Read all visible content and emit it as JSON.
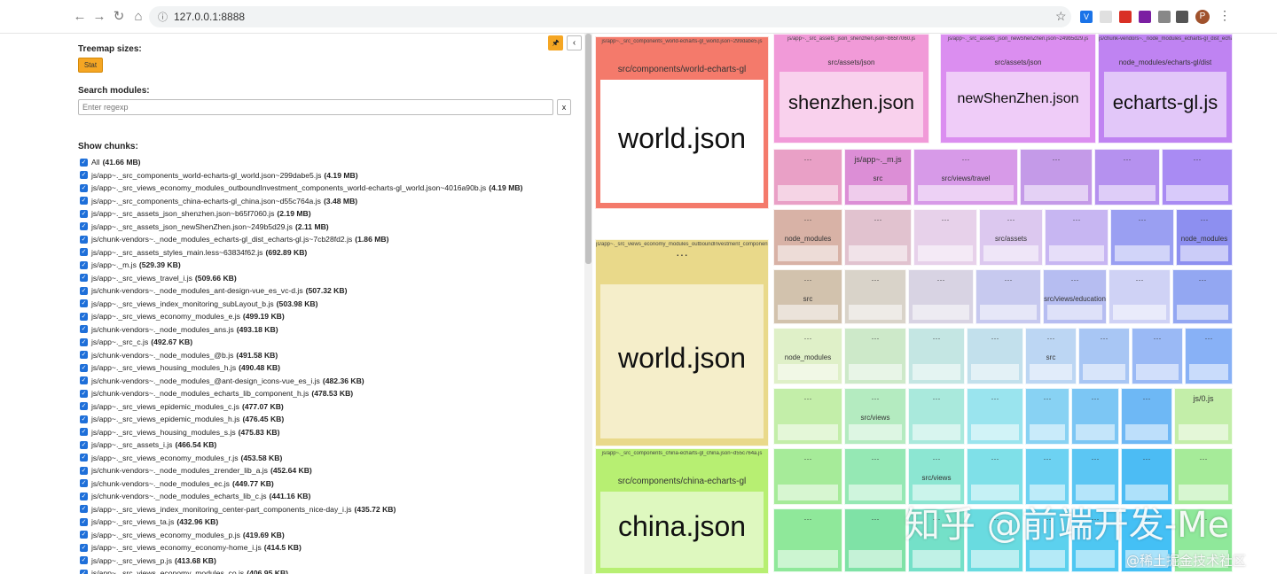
{
  "browser": {
    "url": "127.0.0.1:8888",
    "avatar_letter": "P",
    "menu_glyph": "⋮"
  },
  "sidebar": {
    "treemap_label": "Treemap sizes:",
    "stat_label": "Stat",
    "search_label": "Search modules:",
    "search_placeholder": "Enter regexp",
    "clear_label": "x",
    "pin_label": "🖈",
    "collapse_label": "‹",
    "chunks_label": "Show chunks:",
    "chunks": [
      {
        "name": "All",
        "size": "41.66 MB"
      },
      {
        "name": "js/app~._src_components_world-echarts-gl_world.json~299dabe5.js",
        "size": "4.19 MB"
      },
      {
        "name": "js/app~._src_views_economy_modules_outboundInvestment_components_world-echarts-gl_world.json~4016a90b.js",
        "size": "4.19 MB"
      },
      {
        "name": "js/app~._src_components_china-echarts-gl_china.json~d55c764a.js",
        "size": "3.48 MB"
      },
      {
        "name": "js/app~._src_assets_json_shenzhen.json~b65f7060.js",
        "size": "2.19 MB"
      },
      {
        "name": "js/app~._src_assets_json_newShenZhen.json~249b5d29.js",
        "size": "2.11 MB"
      },
      {
        "name": "js/chunk-vendors~._node_modules_echarts-gl_dist_echarts-gl.js~7cb28fd2.js",
        "size": "1.86 MB"
      },
      {
        "name": "js/app~._src_assets_styles_main.less~63834f62.js",
        "size": "692.89 KB"
      },
      {
        "name": "js/app~._m.js",
        "size": "529.39 KB"
      },
      {
        "name": "js/app~._src_views_travel_i.js",
        "size": "509.66 KB"
      },
      {
        "name": "js/chunk-vendors~._node_modules_ant-design-vue_es_vc-d.js",
        "size": "507.32 KB"
      },
      {
        "name": "js/app~._src_views_index_monitoring_subLayout_b.js",
        "size": "503.98 KB"
      },
      {
        "name": "js/app~._src_views_economy_modules_e.js",
        "size": "499.19 KB"
      },
      {
        "name": "js/chunk-vendors~._node_modules_ans.js",
        "size": "493.18 KB"
      },
      {
        "name": "js/app~._src_c.js",
        "size": "492.67 KB"
      },
      {
        "name": "js/chunk-vendors~._node_modules_@b.js",
        "size": "491.58 KB"
      },
      {
        "name": "js/app~._src_views_housing_modules_h.js",
        "size": "490.48 KB"
      },
      {
        "name": "js/chunk-vendors~._node_modules_@ant-design_icons-vue_es_i.js",
        "size": "482.36 KB"
      },
      {
        "name": "js/chunk-vendors~._node_modules_echarts_lib_component_h.js",
        "size": "478.53 KB"
      },
      {
        "name": "js/app~._src_views_epidemic_modules_c.js",
        "size": "477.07 KB"
      },
      {
        "name": "js/app~._src_views_epidemic_modules_h.js",
        "size": "476.45 KB"
      },
      {
        "name": "js/app~._src_views_housing_modules_s.js",
        "size": "475.83 KB"
      },
      {
        "name": "js/app~._src_assets_i.js",
        "size": "466.54 KB"
      },
      {
        "name": "js/app~._src_views_economy_modules_r.js",
        "size": "453.58 KB"
      },
      {
        "name": "js/chunk-vendors~._node_modules_zrender_lib_a.js",
        "size": "452.64 KB"
      },
      {
        "name": "js/chunk-vendors~._node_modules_ec.js",
        "size": "449.77 KB"
      },
      {
        "name": "js/chunk-vendors~._node_modules_echarts_lib_c.js",
        "size": "441.16 KB"
      },
      {
        "name": "js/app~._src_views_index_monitoring_center-part_components_nice-day_i.js",
        "size": "435.72 KB"
      },
      {
        "name": "js/app~._src_views_ta.js",
        "size": "432.96 KB"
      },
      {
        "name": "js/app~._src_views_economy_modules_p.js",
        "size": "419.69 KB"
      },
      {
        "name": "js/app~._src_views_economy_economy-home_i.js",
        "size": "414.5 KB"
      },
      {
        "name": "js/app~._src_views_p.js",
        "size": "413.68 KB"
      },
      {
        "name": "js/app~._src_views_economy_modules_co.js",
        "size": "406.95 KB"
      }
    ]
  },
  "treemap": {
    "large": [
      {
        "path": "js/app~._src_components_world-echarts-gl_world.json~299dabe5.js",
        "folder": "src/components/world-echarts-gl",
        "file": "world.json",
        "color": "#f47a6b"
      },
      {
        "path": "js/app~._src_views_economy_modules_outboundInvestment_components_world-echarts-gl_world.json",
        "folder": "···",
        "file": "world.json",
        "color": "#e9d98a"
      },
      {
        "path": "js/app~._src_components_china-echarts-gl_china.json~d55c764a.js",
        "folder": "src/components/china-echarts-gl",
        "file": "china.json",
        "color": "#b7ef72"
      }
    ],
    "top": [
      {
        "path": "js/app~._src_assets_json_shenzhen.json~b65f7060.js",
        "folder": "src/assets/json",
        "file": "shenzhen.json",
        "color": "#f19ad8"
      },
      {
        "path": "js/app~._src_assets_json_newShenZhen.json~249b5d29.js",
        "folder": "src/assets/json",
        "file": "newShenZhen.json",
        "color": "#db8ef0"
      },
      {
        "path": "js/chunk-vendors~._node_modules_echarts-gl_dist_echarts-gl.js",
        "folder": "node_modules/echarts-gl/dist",
        "file": "echarts-gl.js",
        "color": "#bf83f2"
      }
    ],
    "small_labels": {
      "main_less_path": "src/assets/styles",
      "main_less": "main.less",
      "app_m": "js/app~._m.js",
      "src": "src",
      "travel": "src/views/travel",
      "node_modules": "node_modules",
      "app_assets": "js/app~._src_assets_i.js",
      "src_assets": "src/assets",
      "app_c": "js/app~._src_c.js",
      "app_m2": "js/app~._m.js",
      "src_views": "src/views",
      "js_o": "js/0.js",
      "education": "src/views/education",
      "ellipsis": "···"
    }
  },
  "watermark": "知乎 @前端开发-Me",
  "watermark2": "@稀土掘金技术社区"
}
